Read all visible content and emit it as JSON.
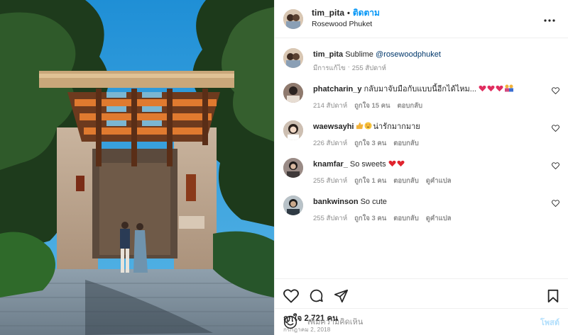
{
  "post": {
    "username": "tim_pita",
    "follow_separator": "•",
    "follow_label": "ติดตาม",
    "location": "Rosewood Phuket",
    "more_icon": "more-horizontal-icon"
  },
  "caption": {
    "username": "tim_pita",
    "text": "Sublime ",
    "mention": "@rosewoodphuket",
    "edited": "มีการแก้ไข",
    "separator": "·",
    "time": "255 สัปดาห์"
  },
  "comments": [
    {
      "username": "phatcharin_y",
      "text": "กลับมาจับมือกับแบบนี้อีกได้ไหม...",
      "emoji": [
        "heart-sparkle",
        "heart-sparkle",
        "heart-sparkle",
        "couple"
      ],
      "time": "214 สัปดาห์",
      "likes": "ถูกใจ 15 คน",
      "reply": "ตอบกลับ"
    },
    {
      "username": "waewsayhi",
      "text": "น่ารักมากมาย",
      "emoji_before": [
        "thumbs-up",
        "star-struck"
      ],
      "time": "226 สัปดาห์",
      "likes": "ถูกใจ 3 คน",
      "reply": "ตอบกลับ"
    },
    {
      "username": "knamfar_",
      "text": "So sweets",
      "emoji": [
        "red-heart",
        "red-heart"
      ],
      "time": "255 สัปดาห์",
      "likes": "ถูกใจ 1 คน",
      "reply": "ตอบกลับ",
      "translate": "ดูคำแปล"
    },
    {
      "username": "bankwinson",
      "text": "So cute",
      "time": "255 สัปดาห์",
      "likes": "ถูกใจ 3 คน",
      "reply": "ตอบกลับ",
      "translate": "ดูคำแปล"
    }
  ],
  "actions": {
    "like_icon": "heart-icon",
    "comment_icon": "comment-icon",
    "share_icon": "share-icon",
    "save_icon": "bookmark-icon"
  },
  "likes_text": "ถูกใจ 2,721 คน",
  "date_text": "กรกฎาคม 2, 2018",
  "compose": {
    "placeholder": "เพิ่มความคิดเห็น",
    "post_label": "โพสต์"
  },
  "colors": {
    "link": "#0095f6",
    "mention": "#00376b",
    "muted": "#8e8e8e",
    "text": "#262626",
    "sky": "#3aa0d8"
  }
}
